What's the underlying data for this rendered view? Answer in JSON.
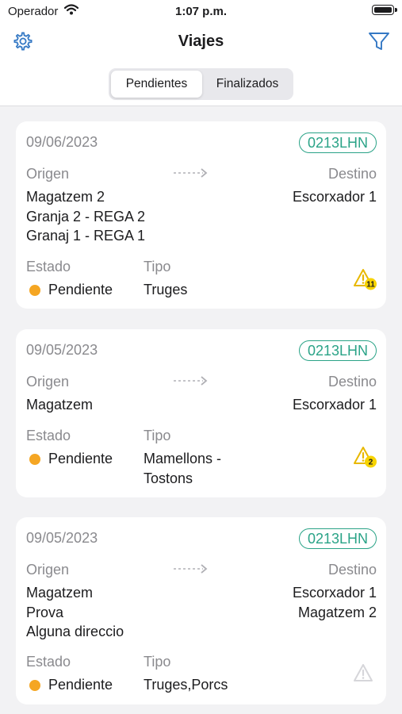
{
  "status_bar": {
    "carrier": "Operador",
    "time": "1:07 p.m."
  },
  "navbar": {
    "title": "Viajes",
    "settings_icon": "gear-icon",
    "filter_icon": "filter-icon"
  },
  "tabs": [
    {
      "label": "Pendientes",
      "selected": true
    },
    {
      "label": "Finalizados",
      "selected": false
    }
  ],
  "labels": {
    "origin": "Origen",
    "destination": "Destino",
    "state": "Estado",
    "type": "Tipo"
  },
  "colors": {
    "accent": "#2aa387",
    "pending": "#f5a623",
    "warning": "#f2c200"
  },
  "trips": [
    {
      "date": "09/06/2023",
      "plate": "0213LHN",
      "origins": [
        "Magatzem 2",
        "Granja 2 - REGA 2",
        "Granaj 1 - REGA 1"
      ],
      "destinations": [
        "Escorxador 1"
      ],
      "state": "Pendiente",
      "type": "Truges",
      "warning_count": "11"
    },
    {
      "date": "09/05/2023",
      "plate": "0213LHN",
      "origins": [
        "Magatzem"
      ],
      "destinations": [
        "Escorxador 1"
      ],
      "state": "Pendiente",
      "type": "Mamellons - Tostons",
      "warning_count": "2"
    },
    {
      "date": "09/05/2023",
      "plate": "0213LHN",
      "origins": [
        "Magatzem",
        "Prova",
        "Alguna direccio"
      ],
      "destinations": [
        "Escorxador 1",
        "Magatzem 2"
      ],
      "state": "Pendiente",
      "type": "Truges,Porcs",
      "warning_count": ""
    }
  ]
}
